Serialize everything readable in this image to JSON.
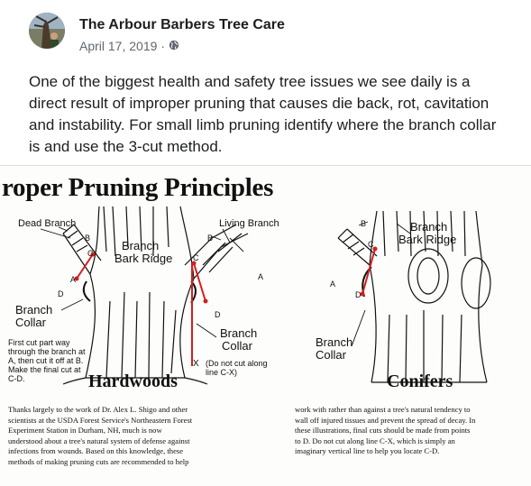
{
  "header": {
    "page_name": "The Arbour Barbers Tree Care",
    "date": "April 17, 2019",
    "separator": "·",
    "privacy_icon": "globe-icon"
  },
  "post": {
    "text": "One of the biggest health and safety tree issues we see daily is a direct result of improper pruning that causes die back, rot, cavitation and instability. For small limb pruning identify where the branch collar is and use the 3-cut method."
  },
  "image": {
    "title": "roper Pruning Principles",
    "hardwoods": {
      "dead_branch": "Dead Branch",
      "living_branch": "Living Branch",
      "branch_bark_ridge_1": "Branch",
      "branch_bark_ridge_2": "Bark Ridge",
      "branch_collar_left_1": "Branch",
      "branch_collar_left_2": "Collar",
      "branch_collar_right_1": "Branch",
      "branch_collar_right_2": "Collar",
      "first_cut_note": "First cut part way through the branch at A, then cut it off at B. Make the final cut at C-D.",
      "do_not_cut": "(Do not cut along line C-X)",
      "x_mark": "X",
      "section_title": "Hardwoods",
      "letters": {
        "a": "A",
        "b": "B",
        "c": "C",
        "d": "D"
      }
    },
    "conifers": {
      "branch_bark_ridge_1": "Branch",
      "branch_bark_ridge_2": "Bark Ridge",
      "branch_collar_1": "Branch",
      "branch_collar_2": "Collar",
      "section_title": "Conifers",
      "letters": {
        "a": "A",
        "b": "B",
        "c": "C",
        "d": "D"
      }
    },
    "caption_left": "Thanks largely to the work of Dr. Alex L. Shigo and other\nscientists at the USDA Forest Service's Northeastern Forest\nExperiment Station in Durham, NH, much is now\nunderstood about a tree's natural system of defense against\ninfections from wounds. Based on this knowledge, these\nmethods of making pruning cuts are recommended to help",
    "caption_right": "work with rather than against a tree's natural tendency to\nwall off injured tissues and prevent the spread of decay. In\nthese illustrations, final cuts should be made from points\nto D. Do not cut along line C-X, which is simply an\nimaginary vertical line to help you locate C-D."
  }
}
